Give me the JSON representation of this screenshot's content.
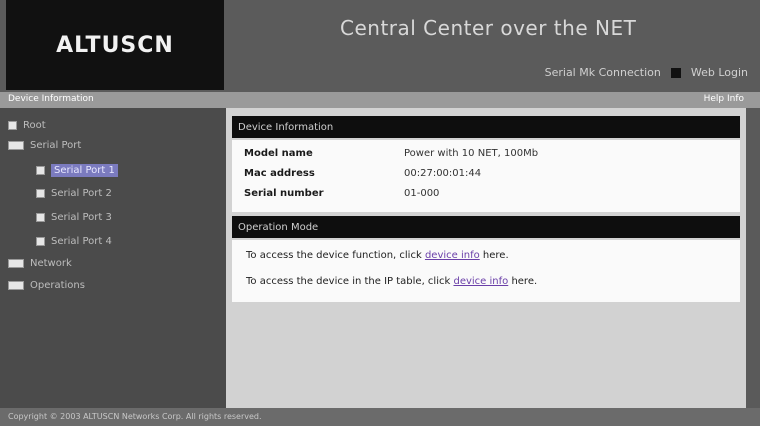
{
  "header": {
    "logo": "ALTUSCN",
    "title": "Central Center over the NET",
    "link_left": "Serial Mk Connection",
    "link_right": "Web Login"
  },
  "toolbar": {
    "left": "Device Information",
    "right": "Help Info"
  },
  "sidebar": {
    "items": [
      {
        "label": "Root"
      },
      {
        "label": "Serial Port"
      },
      {
        "label": "Serial Port 1"
      },
      {
        "label": "Serial Port 2"
      },
      {
        "label": "Serial Port 3"
      },
      {
        "label": "Serial Port 4"
      },
      {
        "label": "Network"
      },
      {
        "label": "Operations"
      }
    ]
  },
  "device_panel": {
    "header": "Device Information",
    "rows": [
      {
        "key": "Model name",
        "value": "Power with 10 NET, 100Mb"
      },
      {
        "key": "Mac address",
        "value": "00:27:00:01:44"
      },
      {
        "key": "Serial number",
        "value": "01-000"
      }
    ]
  },
  "operation_panel": {
    "header": "Operation Mode",
    "msg1_pre": "To access the device function, click",
    "msg1_link": "device info",
    "msg1_post": "here.",
    "msg2_pre": "To access the device in the IP table, click",
    "msg2_link": "device info",
    "msg2_post": "here."
  },
  "footer": {
    "text": "Copyright © 2003 ALTUSCN Networks Corp. All rights reserved."
  }
}
